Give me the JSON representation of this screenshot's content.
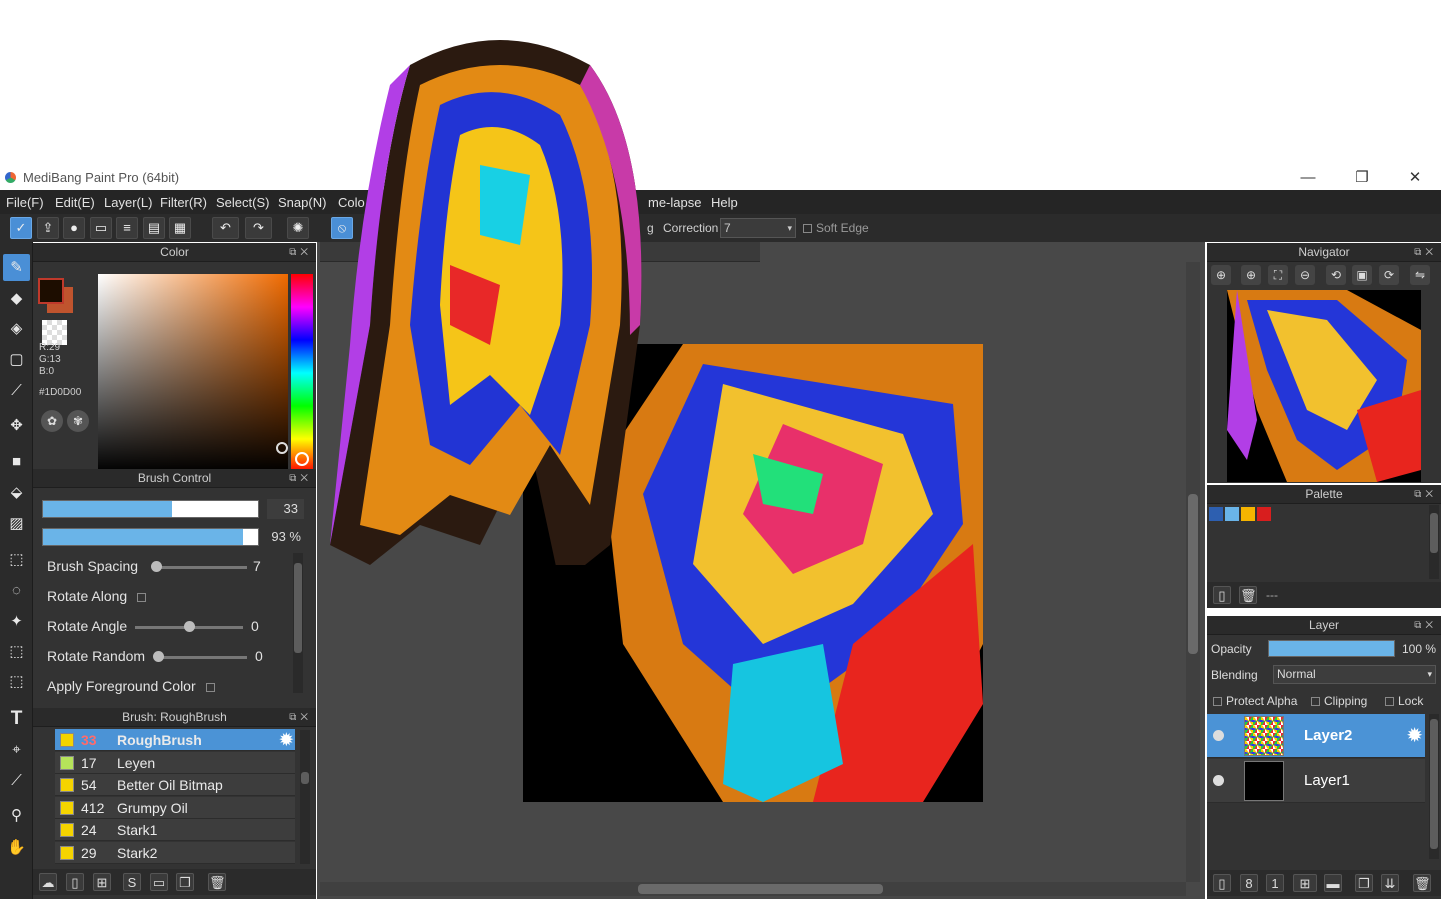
{
  "window": {
    "title": "MediBang Paint Pro (64bit)",
    "minimize": "—",
    "maximize": "❐",
    "close": "✕"
  },
  "menu": [
    "File(F)",
    "Edit(E)",
    "Layer(L)",
    "Filter(R)",
    "Select(S)",
    "Snap(N)",
    "Colo",
    "me-lapse",
    "Help"
  ],
  "toolbar": {
    "partial_label": "g",
    "correction_label": "Correction",
    "correction_value": "7",
    "soft_edge": "Soft Edge"
  },
  "color_panel": {
    "title": "Color",
    "r": "R:29",
    "g": "G:13",
    "b": "B:0",
    "hex": "#1D0D00",
    "fg_color": "#1d0d00",
    "bg_color": "#c0542e"
  },
  "brush_control": {
    "title": "Brush Control",
    "size_value": "33",
    "size_fraction": 0.6,
    "opacity_value": "93 %",
    "opacity_fraction": 0.93,
    "spacing_label": "Brush Spacing",
    "spacing_value": "7",
    "rotate_along_label": "Rotate Along",
    "rotate_angle_label": "Rotate Angle",
    "rotate_angle_value": "0",
    "rotate_random_label": "Rotate Random",
    "rotate_random_value": "0",
    "apply_fg_label": "Apply Foreground Color"
  },
  "brush_list": {
    "title": "Brush: RoughBrush",
    "items": [
      {
        "num": "33",
        "name": "RoughBrush",
        "color": "#f5d400",
        "selected": true
      },
      {
        "num": "17",
        "name": "Leyen",
        "color": "#b5e35a"
      },
      {
        "num": "54",
        "name": "Better Oil Bitmap",
        "color": "#f5d400"
      },
      {
        "num": "412",
        "name": "Grumpy Oil",
        "color": "#f5d400"
      },
      {
        "num": "24",
        "name": "Stark1",
        "color": "#f5d400"
      },
      {
        "num": "29",
        "name": "Stark2",
        "color": "#f5d400"
      }
    ]
  },
  "navigator": {
    "title": "Navigator"
  },
  "palette": {
    "title": "Palette",
    "colors": [
      "#2d5fb0",
      "#6ab4e8",
      "#f5b400",
      "#d81e1e"
    ],
    "empty_label": "---"
  },
  "layer_panel": {
    "title": "Layer",
    "opacity_label": "Opacity",
    "opacity_value": "100 %",
    "opacity_fraction": 1.0,
    "blending_label": "Blending",
    "blending_value": "Normal",
    "protect_alpha": "Protect Alpha",
    "clipping": "Clipping",
    "lock": "Lock",
    "layers": [
      {
        "name": "Layer2",
        "selected": true
      },
      {
        "name": "Layer1",
        "selected": false
      }
    ]
  }
}
